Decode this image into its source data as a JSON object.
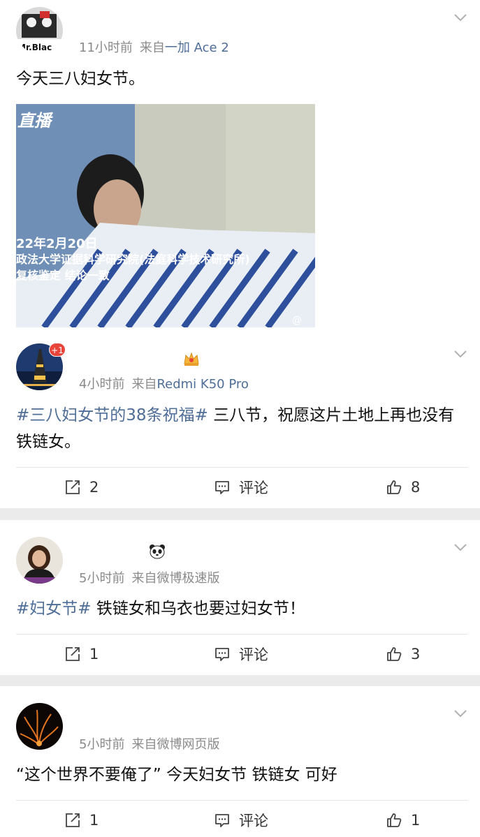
{
  "posts": [
    {
      "time": "11小时前",
      "source_prefix": "来自",
      "source": "一加 Ace 2",
      "text": "今天三八妇女节。",
      "avatar_text": "Mr.Blac",
      "image_overlay": {
        "corner_label": "直播",
        "date": "22年2月20日",
        "line1": "政法大学证据科学研究院(法庭科学技术研究所)",
        "line2": "复核鉴定 结论一致",
        "watermark": "@"
      }
    },
    {
      "time": "4小时前",
      "source_prefix": "来自",
      "source": "Redmi K50 Pro",
      "badge": "+1",
      "hashtag": "#三八妇女节的38条祝福#",
      "text": " 三八节，祝愿这片土地上再也没有铁链女。",
      "share": "2",
      "comment": "评论",
      "like": "8"
    },
    {
      "time": "5小时前",
      "source_prefix": "来自",
      "source": "微博极速版",
      "hashtag": "#妇女节#",
      "text": "  铁链女和乌衣也要过妇女节！",
      "share": "1",
      "comment": "评论",
      "like": "3"
    },
    {
      "time": "5小时前",
      "source_prefix": "来自",
      "source": "微博网页版",
      "text": "“这个世界不要俺了” 今天妇女节  铁链女 可好",
      "share": "1",
      "comment": "评论",
      "like": "1"
    }
  ],
  "icons": {
    "chevron": "chevron-down-icon",
    "crown": "crown-icon",
    "panda": "panda-icon",
    "share": "share-icon",
    "comment": "comment-icon",
    "like": "like-icon"
  },
  "colors": {
    "link": "#4e6e97",
    "meta": "#8a8a8a",
    "badge": "#e8443a",
    "background": "#ebebeb"
  }
}
